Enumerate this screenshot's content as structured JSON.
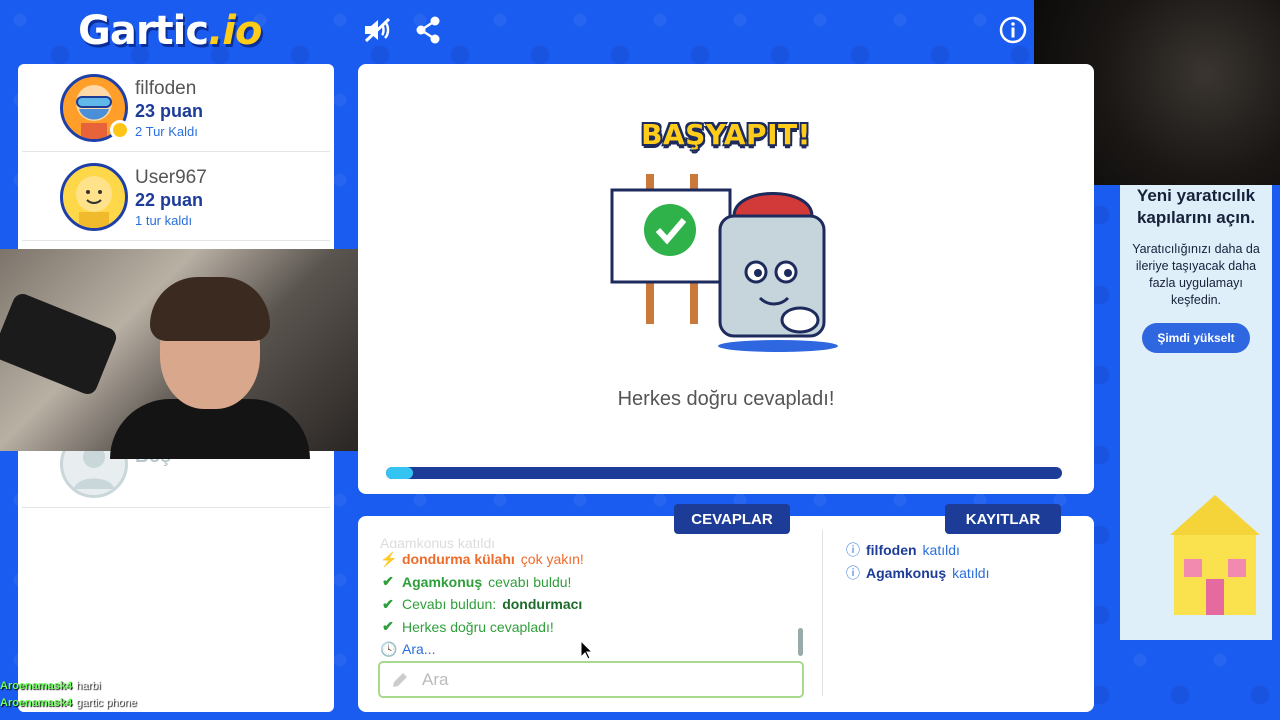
{
  "header": {
    "logo_main": "Gartic",
    "logo_suffix": ".io"
  },
  "players": [
    {
      "name": "filfoden",
      "score": "23 puan",
      "turns": "2 Tur Kaldı"
    },
    {
      "name": "User967",
      "score": "22 puan",
      "turns": "1 tur kaldı"
    },
    {
      "name": "Boş"
    }
  ],
  "main": {
    "title": "BAŞYAPIT!",
    "message": "Herkes doğru cevapladı!",
    "progress": 0.04
  },
  "chat": {
    "answers_tab": "CEVAPLAR",
    "logs_tab": "KAYITLAR",
    "lines": [
      {
        "type": "faded",
        "text": "Agamkonuş katıldı"
      },
      {
        "type": "close",
        "bold": "dondurma külahı",
        "text": "çok yakın!"
      },
      {
        "type": "correct",
        "bold": "Agamkonuş",
        "text": "cevabı buldu!"
      },
      {
        "type": "answer",
        "text": "Cevabı buldun:",
        "bold": "dondurmacı"
      },
      {
        "type": "correct",
        "text": "Herkes doğru cevapladı!"
      },
      {
        "type": "wait",
        "text": "Ara..."
      }
    ],
    "input_placeholder": "Ara",
    "logs": [
      {
        "user": "filfoden",
        "text": "katıldı"
      },
      {
        "user": "Agamkonuş",
        "text": "katıldı"
      }
    ]
  },
  "ad": {
    "headline": "Yeni yaratıcılık kapılarını açın.",
    "body": "Yaratıcılığınızı daha da ileriye taşıyacak daha fazla uygulamayı keşfedin.",
    "button": "Şimdi yükselt"
  },
  "stream_chat": [
    {
      "user": "Aroenamask4",
      "message": "harbi"
    },
    {
      "user": "Aroenamask4",
      "message": "gartic phone"
    }
  ],
  "colors": {
    "background": "#1a5bf0",
    "navy": "#1d3c98",
    "accent_yellow": "#ffcc1a",
    "progress": "#33c4f2",
    "correct": "#2e9f3a",
    "close": "#ef6b2a"
  }
}
